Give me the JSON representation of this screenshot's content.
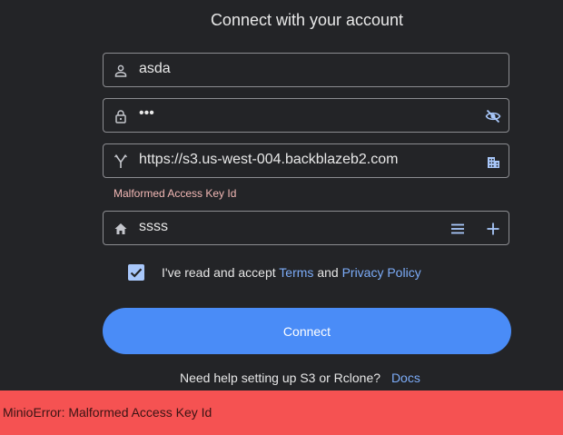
{
  "header": {
    "title": "Connect with your account"
  },
  "fields": {
    "username": {
      "value": "asda",
      "icon": "person-icon"
    },
    "password": {
      "value": "•••",
      "icon": "lock-icon",
      "toggle_icon": "eye-off-icon"
    },
    "endpoint": {
      "value": "https://s3.us-west-004.backblazeb2.com",
      "icon": "fork-icon",
      "trail_icon": "building-icon",
      "error": "Malformed Access Key Id"
    },
    "bucket": {
      "value": "ssss",
      "icon": "home-icon",
      "list_icon": "list-icon",
      "add_icon": "plus-icon"
    }
  },
  "consent": {
    "checked": true,
    "prefix": "I've read and accept",
    "terms": "Terms",
    "and": "and",
    "privacy": "Privacy Policy"
  },
  "connect_button": {
    "label": "Connect"
  },
  "help": {
    "text": "Need help setting up S3 or Rclone?",
    "link": "Docs"
  },
  "toast": {
    "message": "MinioError: Malformed Access Key Id"
  },
  "colors": {
    "primary": "#4a8cf7",
    "link": "#7cacf8",
    "error_text": "#f2b8b5",
    "toast_bg": "#f55252",
    "background": "#232427"
  }
}
